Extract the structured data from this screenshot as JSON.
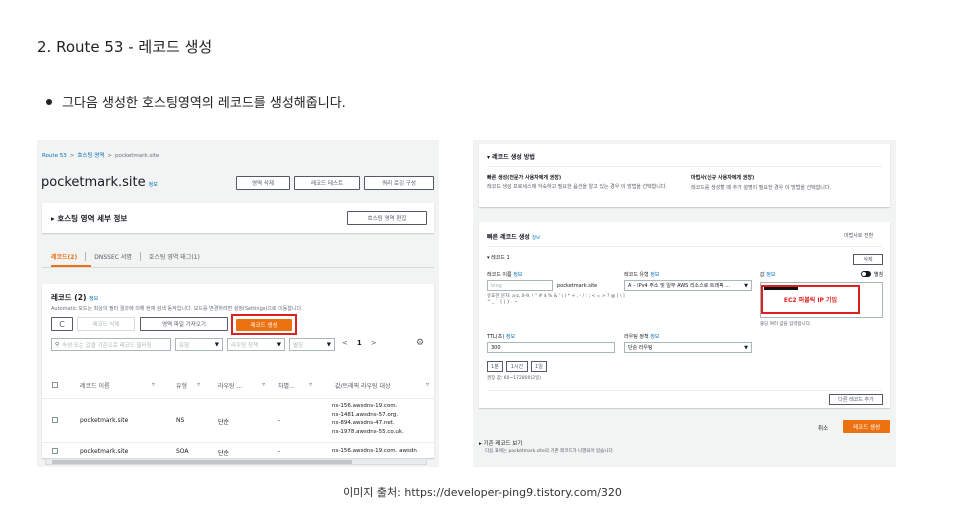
{
  "heading": "2. Route 53 - 레코드 생성",
  "bullet": "그다음 생성한 호스팅영역의 레코드를 생성해줍니다.",
  "caption": "이미지 출처: https://developer-ping9.tistory.com/320",
  "left": {
    "breadcrumb": [
      "Route 53",
      "호스팅 영역",
      "pocketmark.site"
    ],
    "zone_title": "pocketmark.site",
    "info": "정보",
    "buttons": {
      "delete_zone": "영역 삭제",
      "test_record": "레코드 테스트",
      "query_log": "쿼리 로깅 구성"
    },
    "details_title": "▸ 호스팅 영역 세부 정보",
    "edit_zone": "호스팅 영역 편집",
    "tabs": [
      "레코드(2)",
      "DNSSEC 서명",
      "호스팅 영역 태그(1)"
    ],
    "records_title": "레코드 (2)",
    "records_desc": "Automatic 모드는 최상의 필터 결과에 의해 현재 검색 동작입니다. 모드를 변경하려면 설정(Settings)으로 이동합니다.",
    "actions": {
      "refresh": "C",
      "delete_record": "레코드 삭제",
      "import": "영역 파일 가져오기",
      "create_record": "레코드 생성"
    },
    "search_placeholder": "속성 또는 값을 기준으로 레코드 필터링",
    "filters": {
      "type": "유형",
      "policy": "라우팅 정책",
      "alias": "별칭"
    },
    "pagination": {
      "prev": "<",
      "page": "1",
      "next": ">"
    },
    "settings_icon": "gear-icon",
    "columns": [
      "레코드 이름",
      "유형",
      "라우팅 ...",
      "차별...",
      "값/트래픽 라우팅 대상"
    ],
    "rows": [
      {
        "name": "pocketmark.site",
        "type": "NS",
        "policy": "단순",
        "diff": "-",
        "value": [
          "ns-156.awsdns-19.com.",
          "ns-1481.awsdns-57.org.",
          "ns-894.awsdns-47.net.",
          "ns-1978.awsdns-55.co.uk."
        ]
      },
      {
        "name": "pocketmark.site",
        "type": "SOA",
        "policy": "단순",
        "diff": "-",
        "value": [
          "ns-156.awsdns-19.com. awsdn"
        ]
      }
    ]
  },
  "right": {
    "method_title": "▾ 레코드 생성 방법",
    "method_a_title": "빠른 생성(전문가 사용자에게 권장)",
    "method_a_desc": "레코드 생성 프로세스에 익숙하고 필요한 옵션을 알고 있는 경우 이 방법을 선택합니다.",
    "method_b_title": "마법사(신규 사용자에게 권장)",
    "method_b_desc": "레코드를 생성할 때 추가 설명이 필요한 경우 이 방법을 선택합니다.",
    "quick_title": "빠른 레코드 생성",
    "info": "정보",
    "wizard_link": "마법사로 전환",
    "record1": "▾ 레코드 1",
    "delete": "삭제",
    "name_label": "레코드 이름",
    "name_placeholder": "blog",
    "name_suffix": "pocketmark.site",
    "name_hint": "유효한 문자: a-z, 0-9, ! \" # $ % & ' ( ) * + , - / : ; < = > ? @ [ \\ ] ^ _ ` { | } . ~",
    "type_label": "레코드 유형",
    "type_value": "A – IPv4 주소 및 일부 AWS 리소스로 트래픽 ...",
    "value_label": "값",
    "alias_label": "별칭",
    "ec2_note": "EC2 퍼블릭 IP 기입",
    "value_hint": "줄당 여러 값을 입력합니다.",
    "ttl_label": "TTL(초)",
    "ttl_value": "300",
    "ttl_buttons": [
      "1분",
      "1시간",
      "1일"
    ],
    "ttl_hint": "권장 값: 60~172800(2일)",
    "policy_label": "라우팅 정책",
    "policy_value": "단순 라우팅",
    "add_record": "다른 레코드 추가",
    "cancel": "취소",
    "create": "레코드 생성",
    "existing_title": "▸ 기존 레코드 보기",
    "existing_desc": "다음 표에는 pocketmark.site의 기존 레코드가 나열되어 있습니다."
  },
  "colors": {
    "accent": "#ec7211",
    "highlight": "#e0201f",
    "link": "#0073bb"
  }
}
